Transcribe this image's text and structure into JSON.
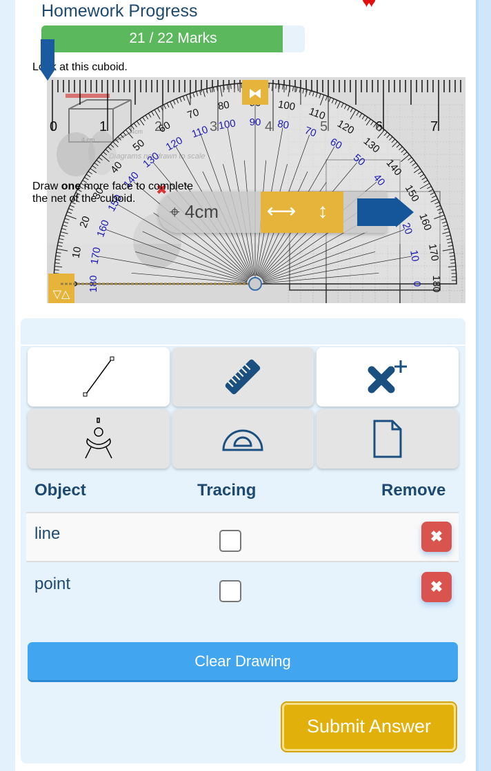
{
  "header": {
    "title": "Homework Progress",
    "progress_label": "21 / 22 Marks",
    "progress_fraction": 0.9545,
    "hearts_icon": "hearts-icon"
  },
  "question": {
    "intro": "Look at this cuboid.",
    "instruction_pre": "Draw ",
    "instruction_bold": "one",
    "instruction_post": " more face to complete the net of the cuboid.",
    "note": "Diagrams not drawn to scale",
    "dim1": "4 cm",
    "dim2": "4cm"
  },
  "ruler": {
    "labels": [
      "0",
      "1",
      "2",
      "3",
      "4",
      "5",
      "6",
      "7"
    ]
  },
  "protractor": {
    "outer_labels": [
      "0",
      "10",
      "20",
      "30",
      "40",
      "50",
      "60",
      "70",
      "80",
      "90",
      "100",
      "110",
      "120",
      "130",
      "140",
      "150",
      "160",
      "170",
      "180"
    ],
    "inner_labels": [
      "180",
      "170",
      "160",
      "150",
      "140",
      "130",
      "120",
      "110",
      "100",
      "90",
      "80",
      "70",
      "60",
      "50",
      "40",
      "30",
      "20",
      "10",
      "0"
    ]
  },
  "overlay": {
    "length_label": "4cm",
    "move_icon": "move-icon",
    "horizontal_icon": "horizontal-arrows-icon",
    "vertical_icon": "vertical-arrows-icon"
  },
  "tools": [
    {
      "icon": "line-segment-icon"
    },
    {
      "icon": "ruler-icon"
    },
    {
      "icon": "add-point-icon"
    },
    {
      "icon": "compass-icon"
    },
    {
      "icon": "protractor-icon"
    },
    {
      "icon": "new-page-icon"
    }
  ],
  "table": {
    "headers": [
      "Object",
      "Tracing",
      "Remove"
    ],
    "rows": [
      {
        "object": "line",
        "tracing": false
      },
      {
        "object": "point",
        "tracing": false
      }
    ]
  },
  "buttons": {
    "clear": "Clear Drawing",
    "submit": "Submit Answer"
  },
  "colors": {
    "progress": "#5cb85c",
    "accent": "#1e4a72",
    "remove": "#d9534f",
    "clear": "#42a5ef",
    "submit": "#e2b00a",
    "inner_scale": "#1a1ab0"
  }
}
